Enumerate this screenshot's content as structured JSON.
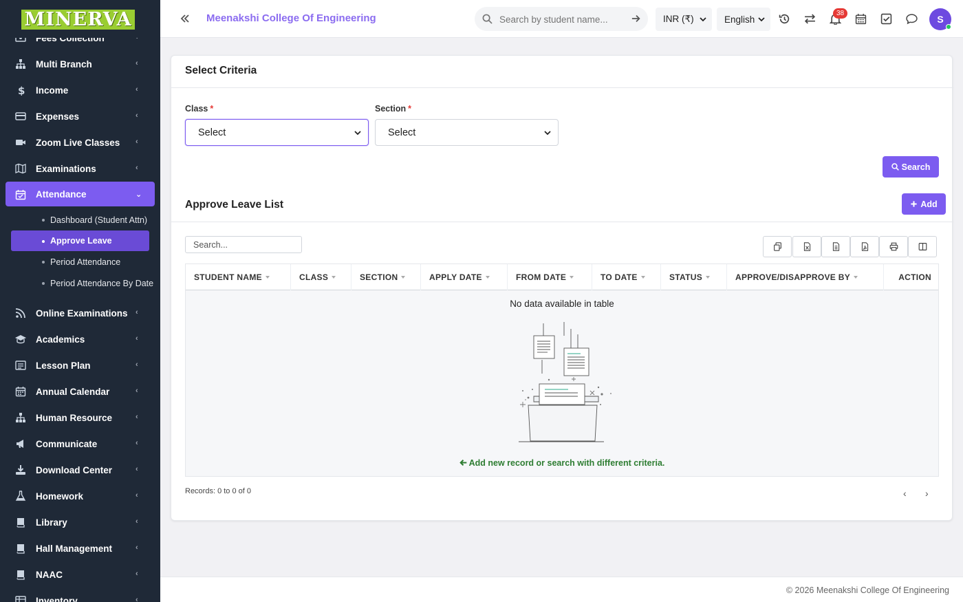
{
  "app": {
    "logo_text": "MINERVA",
    "college_name": "Meenakshi College Of Engineering"
  },
  "header": {
    "search_placeholder": "Search by student name...",
    "currency": "INR (₹)",
    "language": "English",
    "notifications_count": "38",
    "avatar_initial": "S"
  },
  "sidebar": {
    "items_top": [
      "Fees Collection",
      "Multi Branch",
      "Income",
      "Expenses",
      "Zoom Live Classes",
      "Examinations"
    ],
    "active_item": "Attendance",
    "subitems": [
      "Dashboard (Student Attn)",
      "Approve Leave",
      "Period Attendance",
      "Period Attendance By Date"
    ],
    "active_subitem_index": 1,
    "items_bottom": [
      "Online Examinations",
      "Academics",
      "Lesson Plan",
      "Annual Calendar",
      "Human Resource",
      "Communicate",
      "Download Center",
      "Homework",
      "Library",
      "Hall Management",
      "NAAC",
      "Inventory"
    ]
  },
  "criteria": {
    "title": "Select Criteria",
    "class_label": "Class",
    "section_label": "Section",
    "required_mark": "*",
    "class_value": "Select",
    "section_value": "Select",
    "search_button": "Search"
  },
  "list": {
    "title": "Approve Leave List",
    "add_button": "Add",
    "search_placeholder": "Search...",
    "columns": [
      "STUDENT NAME",
      "CLASS",
      "SECTION",
      "APPLY DATE",
      "FROM DATE",
      "TO DATE",
      "STATUS",
      "APPROVE/DISAPPROVE BY",
      "ACTION"
    ],
    "empty_text": "No data available in table",
    "hint_text": "Add new record or search with different criteria.",
    "records_text": "Records: 0 to 0 of 0"
  },
  "footer": {
    "copyright": "© 2026 Meenakshi College Of Engineering"
  },
  "colors": {
    "accent": "#7c5cf0",
    "sidebar_bg": "#1f2937",
    "hint_green": "#2e7d32",
    "badge_red": "#e53935"
  }
}
